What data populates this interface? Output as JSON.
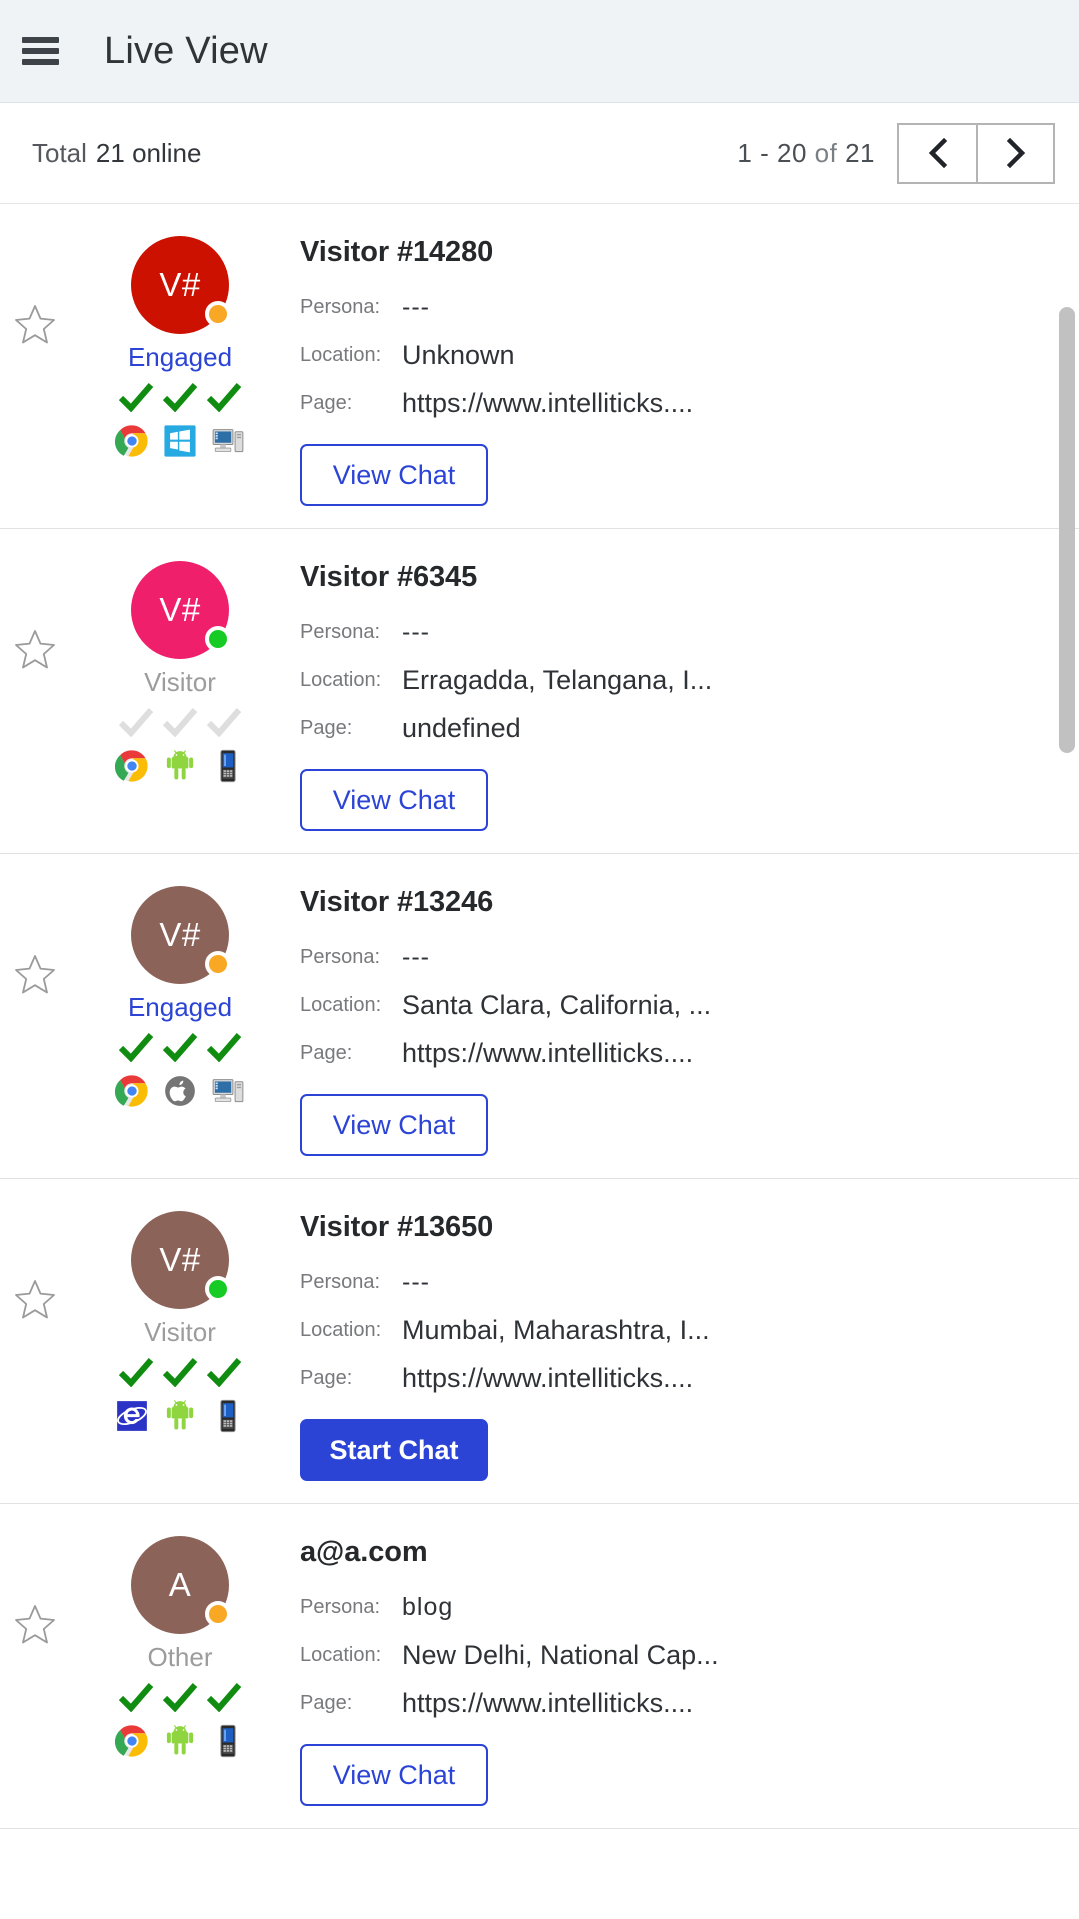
{
  "header": {
    "menu_icon": "hamburger-icon",
    "title": "Live View"
  },
  "toolbar": {
    "total_label": "Total",
    "total_value": "21 online",
    "page_range_start": "1 - 20",
    "page_range_of": "of",
    "page_range_total": "21",
    "prev_icon": "chevron-left-icon",
    "next_icon": "chevron-right-icon"
  },
  "labels": {
    "persona": "Persona:",
    "location": "Location:",
    "page": "Page:"
  },
  "colors": {
    "accent_blue": "#2b44d6",
    "avatar_red": "#cc1100",
    "avatar_pink": "#ef1f6c",
    "avatar_brown": "#8c6359",
    "dot_orange": "#f9a825",
    "dot_green": "#16cc24",
    "check_green": "#108c10",
    "check_grey": "#dedede",
    "header_bg": "#eff3f6"
  },
  "scrollbar": {
    "thumb_top_pct": 6,
    "thumb_height_pct": 26
  },
  "visitors": [
    {
      "initials": "V#",
      "avatar_color": "#cc1100",
      "status_dot": "#f9a825",
      "state": "Engaged",
      "state_style": "engaged",
      "checks": [
        "green",
        "green",
        "green"
      ],
      "tech_icons": [
        "chrome-icon",
        "windows-icon",
        "desktop-icon"
      ],
      "name": "Visitor #14280",
      "persona": "---",
      "location": "Unknown",
      "page": "https://www.intelliticks....",
      "action_label": "View Chat",
      "action_style": "outline"
    },
    {
      "initials": "V#",
      "avatar_color": "#ef1f6c",
      "status_dot": "#16cc24",
      "state": "Visitor",
      "state_style": "plain",
      "checks": [
        "grey",
        "grey",
        "grey"
      ],
      "tech_icons": [
        "chrome-icon",
        "android-icon",
        "mobile-icon"
      ],
      "name": "Visitor #6345",
      "persona": "---",
      "location": "Erragadda, Telangana, I...",
      "page": "undefined",
      "action_label": "View Chat",
      "action_style": "outline"
    },
    {
      "initials": "V#",
      "avatar_color": "#8c6359",
      "status_dot": "#f9a825",
      "state": "Engaged",
      "state_style": "engaged",
      "checks": [
        "green",
        "green",
        "green"
      ],
      "tech_icons": [
        "chrome-icon",
        "apple-icon",
        "desktop-icon"
      ],
      "name": "Visitor #13246",
      "persona": "---",
      "location": "Santa Clara, California, ...",
      "page": "https://www.intelliticks....",
      "action_label": "View Chat",
      "action_style": "outline"
    },
    {
      "initials": "V#",
      "avatar_color": "#8c6359",
      "status_dot": "#16cc24",
      "state": "Visitor",
      "state_style": "plain",
      "checks": [
        "green",
        "green",
        "green"
      ],
      "tech_icons": [
        "internet-explorer-icon",
        "android-icon",
        "mobile-icon"
      ],
      "name": "Visitor #13650",
      "persona": "---",
      "location": "Mumbai, Maharashtra, I...",
      "page": "https://www.intelliticks....",
      "action_label": "Start Chat",
      "action_style": "filled"
    },
    {
      "initials": "A",
      "avatar_color": "#8c6359",
      "status_dot": "#f9a825",
      "state": "Other",
      "state_style": "plain",
      "checks": [
        "green",
        "green",
        "green"
      ],
      "tech_icons": [
        "chrome-icon",
        "android-icon",
        "mobile-icon"
      ],
      "name": "a@a.com",
      "persona": "blog",
      "location": "New Delhi, National Cap...",
      "page": "https://www.intelliticks....",
      "action_label": "View Chat",
      "action_style": "outline"
    }
  ]
}
